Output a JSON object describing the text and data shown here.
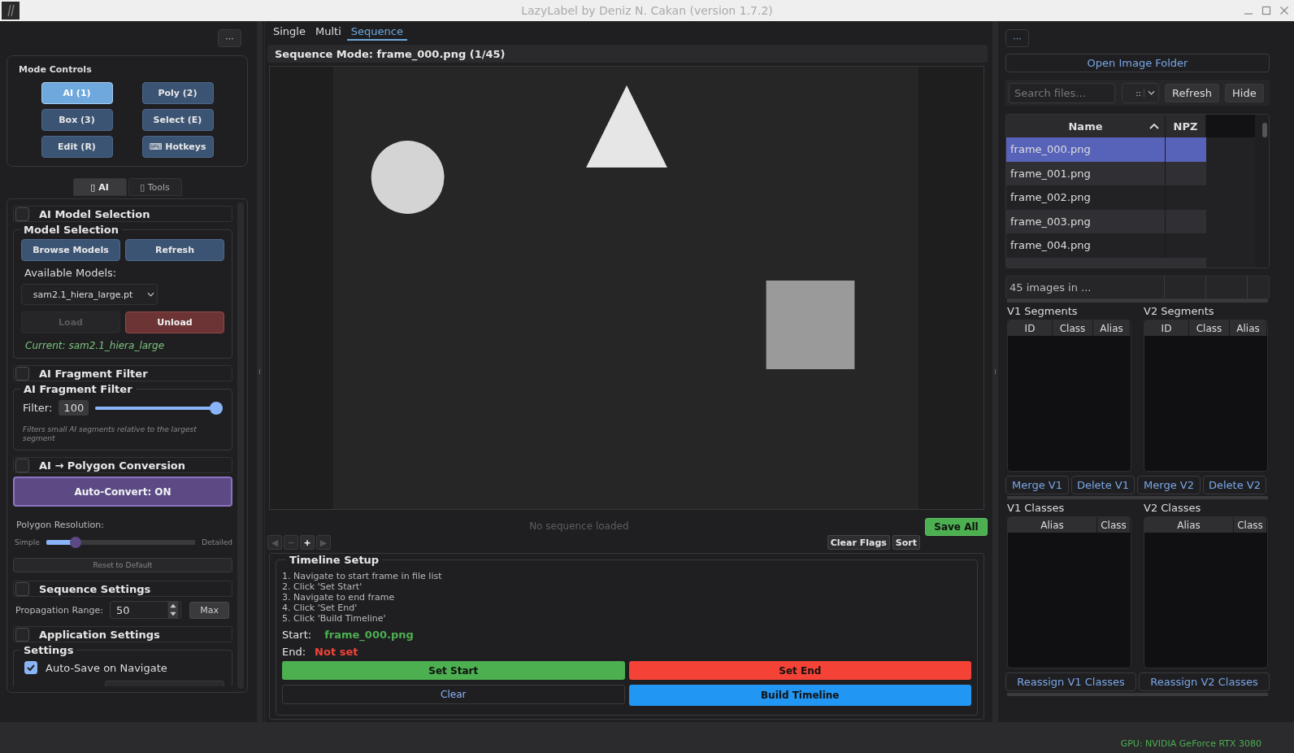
{
  "window": {
    "title": "LazyLabel by Deniz N. Cakan (version 1.7.2)"
  },
  "left_panel": {
    "menu_button": "···",
    "mode_controls": {
      "title": "Mode Controls",
      "buttons": [
        {
          "label": "AI (1)",
          "selected": true
        },
        {
          "label": "Poly (2)",
          "selected": false
        },
        {
          "label": "Box (3)",
          "selected": false
        },
        {
          "label": "Select (E)",
          "selected": false
        },
        {
          "label": "Edit (R)",
          "selected": false
        },
        {
          "label": "⌨ Hotkeys",
          "selected": false
        }
      ]
    },
    "tabs": [
      {
        "label": "▯ AI",
        "selected": true
      },
      {
        "label": "▯ Tools",
        "selected": false
      }
    ],
    "ai_model_selection": {
      "header": "AI Model Selection",
      "checked": false,
      "group_title": "Model Selection",
      "browse_button": "Browse Models",
      "refresh_button": "Refresh",
      "available_label": "Available Models:",
      "model_dropdown": "sam2.1_hiera_large.pt",
      "load_button": {
        "label": "Load",
        "disabled": true
      },
      "unload_button": "Unload",
      "current": "Current: sam2.1_hiera_large"
    },
    "fragment_filter": {
      "header": "AI Fragment Filter",
      "checked": false,
      "group_title": "AI Fragment Filter",
      "filter_label": "Filter:",
      "filter_value": "100",
      "level": 1,
      "hint": "Filters small AI segments relative to the largest segment"
    },
    "polygon_conversion": {
      "header": "AI → Polygon Conversion",
      "checked": false,
      "auto_convert_button": "Auto-Convert: ON",
      "resolution_label": "Polygon Resolution:",
      "min_label": "Simple",
      "max_label": "Detailed",
      "level": 0.17,
      "reset_button": "Reset to Default"
    },
    "sequence_settings": {
      "header": "Sequence Settings",
      "checked": false,
      "range_label": "Propagation Range:",
      "range_value": "50",
      "max_button": "Max"
    },
    "application_settings": {
      "header": "Application Settings",
      "checked": false,
      "group_title": "Settings",
      "options": [
        {
          "label": "Auto-Save on Navigate",
          "checked": true
        }
      ]
    }
  },
  "center_panel": {
    "tabs": [
      {
        "label": "Single",
        "selected": false
      },
      {
        "label": "Multi",
        "selected": false
      },
      {
        "label": "Sequence",
        "selected": true
      }
    ],
    "header": "Sequence Mode: frame_000.png (1/45)",
    "status": "No sequence loaded",
    "save_all_button": "Save All",
    "nav_buttons": [
      {
        "label": "◀",
        "disabled": true
      },
      {
        "label": "−",
        "disabled": true
      },
      {
        "label": "+",
        "disabled": false
      },
      {
        "label": "▶",
        "disabled": true
      }
    ],
    "clear_flags_button": "Clear Flags",
    "sort_button": "Sort",
    "timeline": {
      "title": "Timeline Setup",
      "steps": [
        "1. Navigate to start frame in file list",
        "2. Click 'Set Start'",
        "3. Navigate to end frame",
        "4. Click 'Set End'",
        "5. Click 'Build Timeline'"
      ],
      "start_label": "Start:",
      "start_value": "frame_000.png",
      "end_label": "End:",
      "end_value": "Not set",
      "buttons": [
        {
          "label": "Set Start",
          "kind": "start"
        },
        {
          "label": "Set End",
          "kind": "end"
        },
        {
          "label": "Clear",
          "kind": "clear"
        },
        {
          "label": "Build Timeline",
          "kind": "build"
        }
      ]
    }
  },
  "right_panel": {
    "menu_button": "···",
    "open_folder_button": "Open Image Folder",
    "search": {
      "placeholder": "Search files..."
    },
    "filter_dropdown": "::",
    "refresh_button": "Refresh",
    "hide_button": "Hide",
    "file_table": {
      "columns": [
        "Name",
        "NPZ"
      ],
      "rows": [
        {
          "name": "frame_000.png",
          "selected": true
        },
        {
          "name": "frame_001.png",
          "selected": false
        },
        {
          "name": "frame_002.png",
          "selected": false
        },
        {
          "name": "frame_003.png",
          "selected": false
        },
        {
          "name": "frame_004.png",
          "selected": false
        }
      ]
    },
    "summary": "45 images in ...",
    "segment_tables": [
      {
        "title": "V1 Segments",
        "columns": [
          "ID",
          "Class",
          "Alias"
        ]
      },
      {
        "title": "V2 Segments",
        "columns": [
          "ID",
          "Class",
          "Alias"
        ]
      }
    ],
    "segment_buttons": [
      "Merge V1",
      "Delete V1",
      "Merge V2",
      "Delete V2"
    ],
    "class_tables": [
      {
        "title": "V1 Classes",
        "columns": [
          "Alias",
          "Class"
        ]
      },
      {
        "title": "V2 Classes",
        "columns": [
          "Alias",
          "Class"
        ]
      }
    ],
    "class_buttons": [
      "Reassign V1 Classes",
      "Reassign V2 Classes"
    ]
  },
  "status_bar": {
    "gpu": "GPU: NVIDIA GeForce RTX 3080"
  }
}
